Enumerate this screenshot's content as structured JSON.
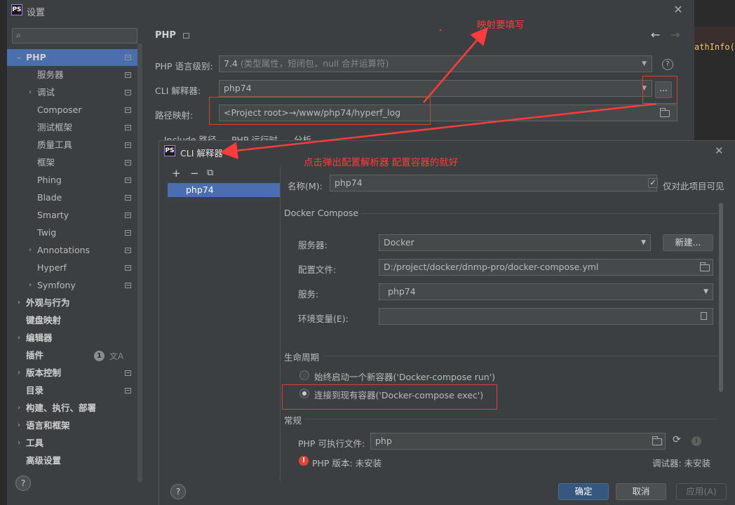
{
  "background_editor": {
    "right_code": "athInfo("
  },
  "settings": {
    "logo": "PS",
    "title": "设置",
    "search": {
      "placeholder": ""
    },
    "sidebar": [
      {
        "label": "PHP",
        "indent": 0,
        "arrow": "open",
        "selected": true,
        "bold": true,
        "icon": true
      },
      {
        "label": "服务器",
        "indent": 1,
        "arrow": "none",
        "icon": true
      },
      {
        "label": "调试",
        "indent": 1,
        "arrow": "closed",
        "icon": true
      },
      {
        "label": "Composer",
        "indent": 1,
        "arrow": "none",
        "icon": true
      },
      {
        "label": "测试框架",
        "indent": 1,
        "arrow": "none",
        "icon": true
      },
      {
        "label": "质量工具",
        "indent": 1,
        "arrow": "none",
        "icon": true
      },
      {
        "label": "框架",
        "indent": 1,
        "arrow": "none",
        "icon": true
      },
      {
        "label": "Phing",
        "indent": 1,
        "arrow": "none",
        "icon": true
      },
      {
        "label": "Blade",
        "indent": 1,
        "arrow": "none",
        "icon": true
      },
      {
        "label": "Smarty",
        "indent": 1,
        "arrow": "none",
        "icon": true
      },
      {
        "label": "Twig",
        "indent": 1,
        "arrow": "none",
        "icon": true
      },
      {
        "label": "Annotations",
        "indent": 1,
        "arrow": "closed",
        "icon": true
      },
      {
        "label": "Hyperf",
        "indent": 1,
        "arrow": "none",
        "icon": true
      },
      {
        "label": "Symfony",
        "indent": 1,
        "arrow": "closed",
        "icon": true
      },
      {
        "label": "外观与行为",
        "indent": 0,
        "arrow": "closed",
        "bold": true,
        "icon": false
      },
      {
        "label": "键盘映射",
        "indent": 0,
        "arrow": "none",
        "bold": true,
        "icon": false
      },
      {
        "label": "编辑器",
        "indent": 0,
        "arrow": "closed",
        "bold": true,
        "icon": false
      },
      {
        "label": "插件",
        "indent": 0,
        "arrow": "none",
        "bold": true,
        "icon": false,
        "badge": "1"
      },
      {
        "label": "版本控制",
        "indent": 0,
        "arrow": "closed",
        "bold": true,
        "icon": true
      },
      {
        "label": "目录",
        "indent": 0,
        "arrow": "none",
        "bold": true,
        "icon": true
      },
      {
        "label": "构建、执行、部署",
        "indent": 0,
        "arrow": "closed",
        "bold": true,
        "icon": false
      },
      {
        "label": "语言和框架",
        "indent": 0,
        "arrow": "closed",
        "bold": true,
        "icon": false
      },
      {
        "label": "工具",
        "indent": 0,
        "arrow": "closed",
        "bold": true,
        "icon": false
      },
      {
        "label": "高级设置",
        "indent": 0,
        "arrow": "none",
        "bold": true,
        "icon": false
      }
    ],
    "help": "?",
    "main": {
      "title": "PHP",
      "nav_back": "←",
      "nav_forward": "→",
      "language_label": "PHP 语言级别:",
      "language_value": "7.4",
      "language_hint": "(类型属性，短闭包，null 合并运算符)",
      "cli_label": "CLI 解释器:",
      "cli_value": "php74",
      "dots": "...",
      "path_label": "路径映射:",
      "path_value": "<Project root>→/www/php74/hyperf_log",
      "tabs": [
        "Include 路径",
        "PHP 运行时",
        "分析"
      ]
    }
  },
  "cli_dialog": {
    "logo": "PS",
    "title": "CLI 解释器",
    "toolbar": [
      "+",
      "−",
      "⧉"
    ],
    "interpreters": [
      "php74"
    ],
    "name_label": "名称(M):",
    "name_value": "php74",
    "project_only_label": "仅对此项目可见",
    "project_only_checked": true,
    "docker_section": "Docker Compose",
    "server_label": "服务器:",
    "server_value": "Docker",
    "new_button": "新建...",
    "config_label": "配置文件:",
    "config_value": "D:/project/docker/dnmp-pro/docker-compose.yml",
    "service_label": "服务:",
    "service_value": "php74",
    "env_label": "环境变量(E):",
    "env_value": "",
    "lifecycle_section": "生命周期",
    "radio_run": "始终启动一个新容器('Docker-compose run')",
    "radio_exec": "连接到现有容器('Docker-compose exec')",
    "radio_selected": "exec",
    "general_section": "常规",
    "php_exec_label": "PHP 可执行文件:",
    "php_exec_value": "php",
    "php_version_text": "PHP 版本: 未安装",
    "debugger_text": "调试器: 未安装",
    "ok": "确定",
    "cancel": "取消",
    "apply": "应用(A)",
    "help": "?"
  },
  "annotations": {
    "mapping_note": "映射要填写",
    "popup_note": "点击弹出配置解析器 配置容器的就好"
  },
  "colors": {
    "accent": "#4b6eaf",
    "annotation": "#ff3b3b",
    "primary_button": "#365880"
  }
}
